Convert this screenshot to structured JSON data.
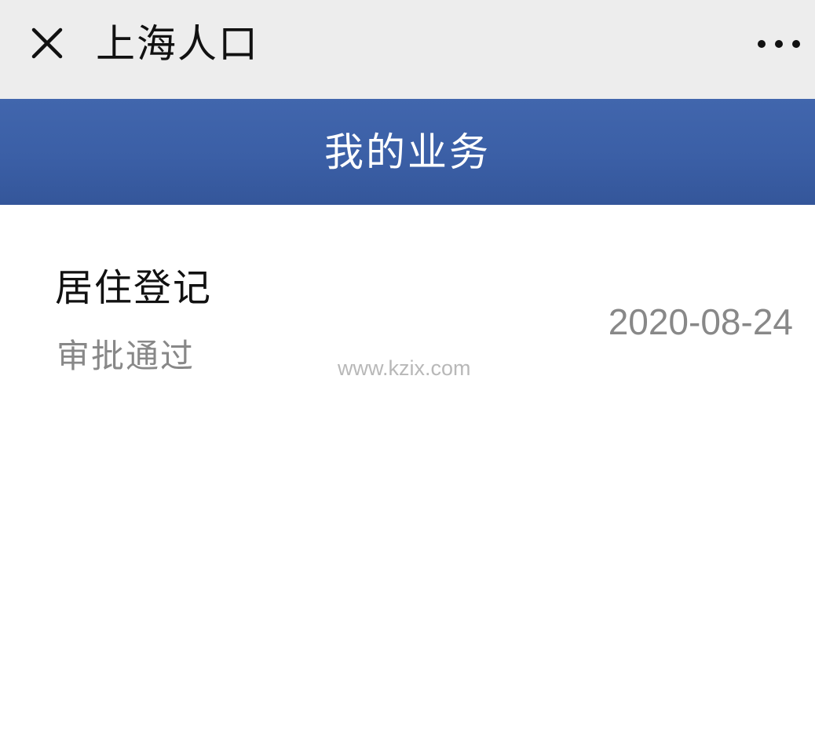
{
  "title_bar": {
    "title": "上海人口",
    "close_icon": "close-icon",
    "more_icon": "more-horizontal-icon",
    "background": "#ededed"
  },
  "header": {
    "title": "我的业务",
    "background": "#3b5fa6"
  },
  "business_list": [
    {
      "name": "居住登记",
      "status": "审批通过",
      "date": "2020-08-24"
    }
  ],
  "watermark": "www.kzix.com"
}
